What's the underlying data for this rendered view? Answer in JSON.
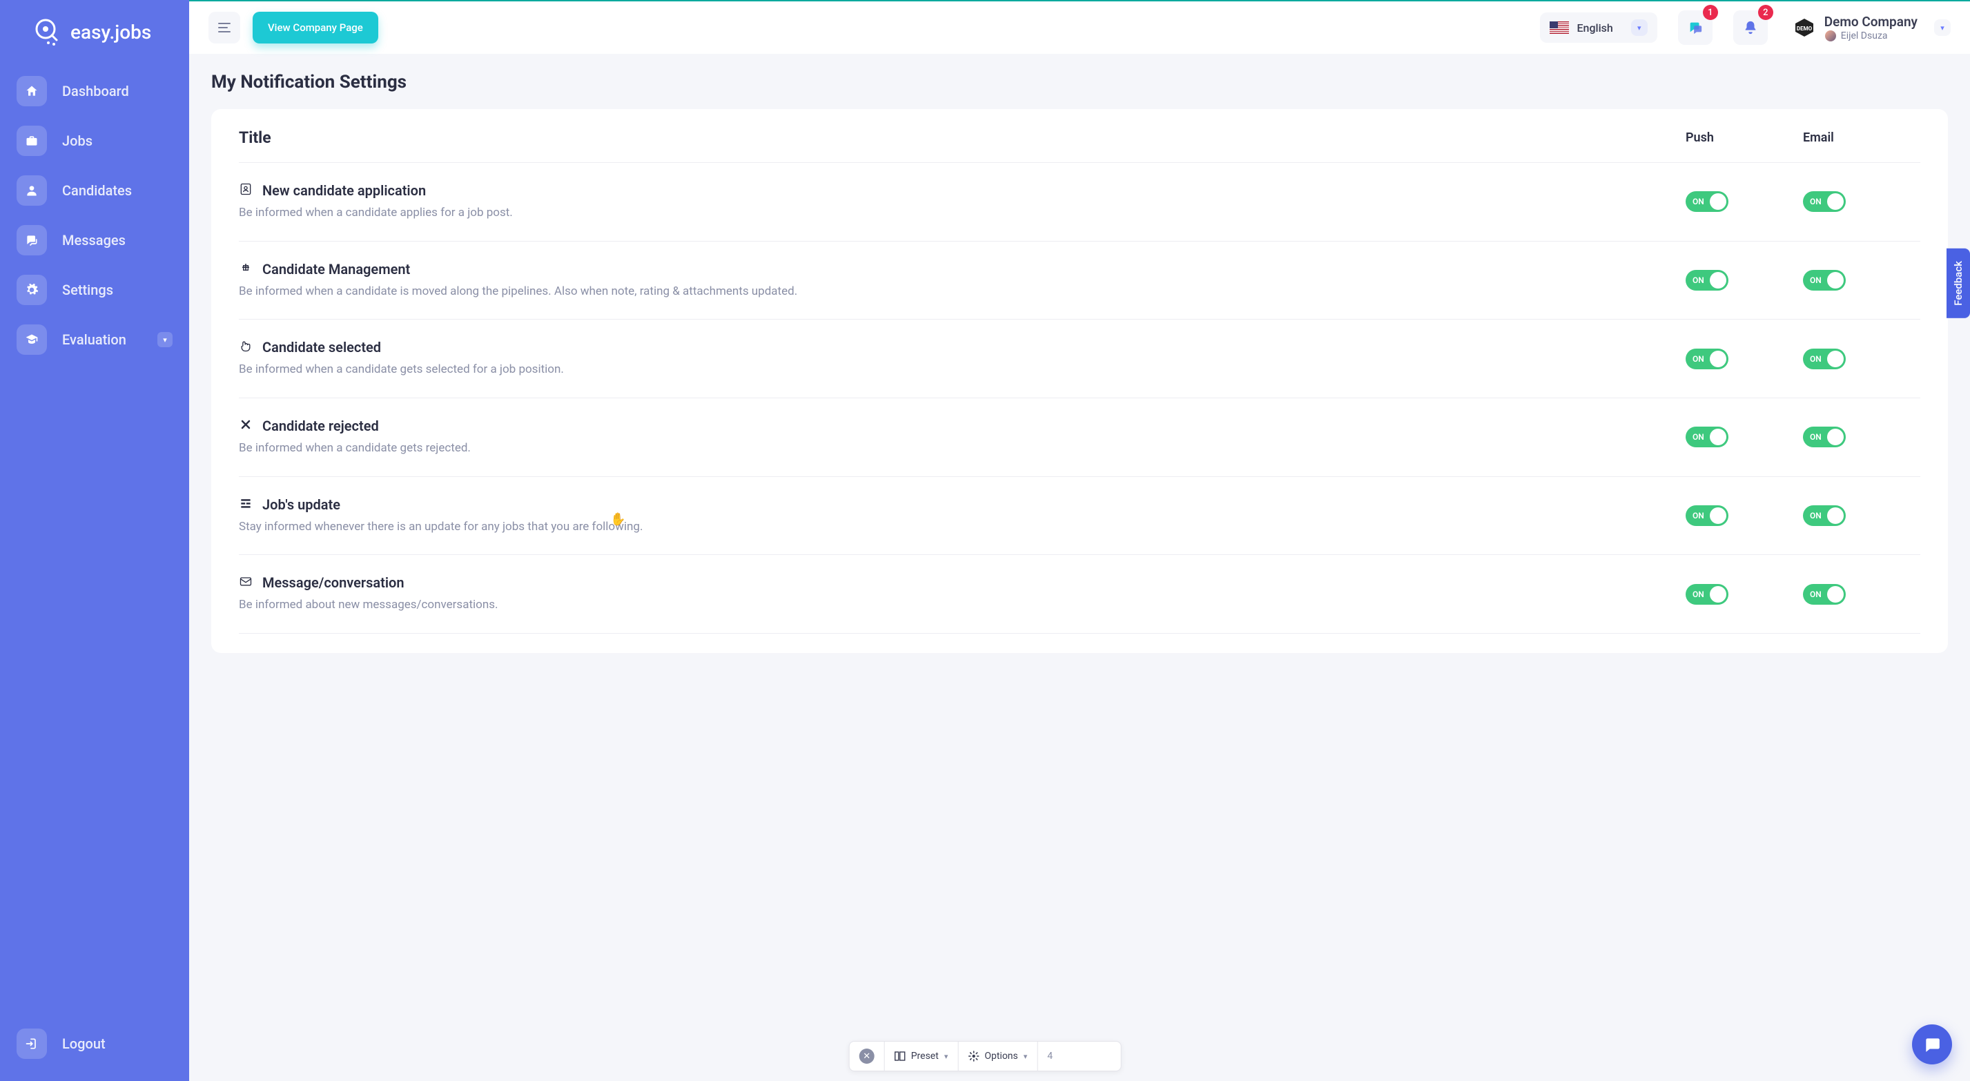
{
  "brand": {
    "name": "easy.jobs"
  },
  "sidebar": {
    "items": [
      {
        "label": "Dashboard"
      },
      {
        "label": "Jobs"
      },
      {
        "label": "Candidates"
      },
      {
        "label": "Messages"
      },
      {
        "label": "Settings"
      },
      {
        "label": "Evaluation"
      }
    ],
    "logout": "Logout"
  },
  "header": {
    "view_company": "View Company Page",
    "language": "English",
    "badge_messages": "1",
    "badge_notifications": "2",
    "company": "Demo Company",
    "user": "Eijel Dsuza"
  },
  "page": {
    "title": "My Notification Settings",
    "columns": {
      "title": "Title",
      "push": "Push",
      "email": "Email"
    },
    "rows": [
      {
        "title": "New candidate application",
        "desc": "Be informed when a candidate applies for a job post.",
        "push": "ON",
        "email": "ON",
        "icon": "id-badge"
      },
      {
        "title": "Candidate Management",
        "desc": "Be informed when a candidate is moved along the pipelines. Also when note, rating & attachments updated.",
        "push": "ON",
        "email": "ON",
        "icon": "plus-square"
      },
      {
        "title": "Candidate selected",
        "desc": "Be informed when a candidate gets selected for a job position.",
        "push": "ON",
        "email": "ON",
        "icon": "hand-up"
      },
      {
        "title": "Candidate rejected",
        "desc": "Be informed when a candidate gets rejected.",
        "push": "ON",
        "email": "ON",
        "icon": "x"
      },
      {
        "title": "Job's update",
        "desc": "Stay informed whenever there is an update for any jobs that you are following.",
        "push": "ON",
        "email": "ON",
        "icon": "list"
      },
      {
        "title": "Message/conversation",
        "desc": "Be informed about new messages/conversations.",
        "push": "ON",
        "email": "ON",
        "icon": "envelope"
      }
    ]
  },
  "feedback": "Feedback",
  "floating": {
    "preset": "Preset",
    "options": "Options",
    "page": "4"
  }
}
